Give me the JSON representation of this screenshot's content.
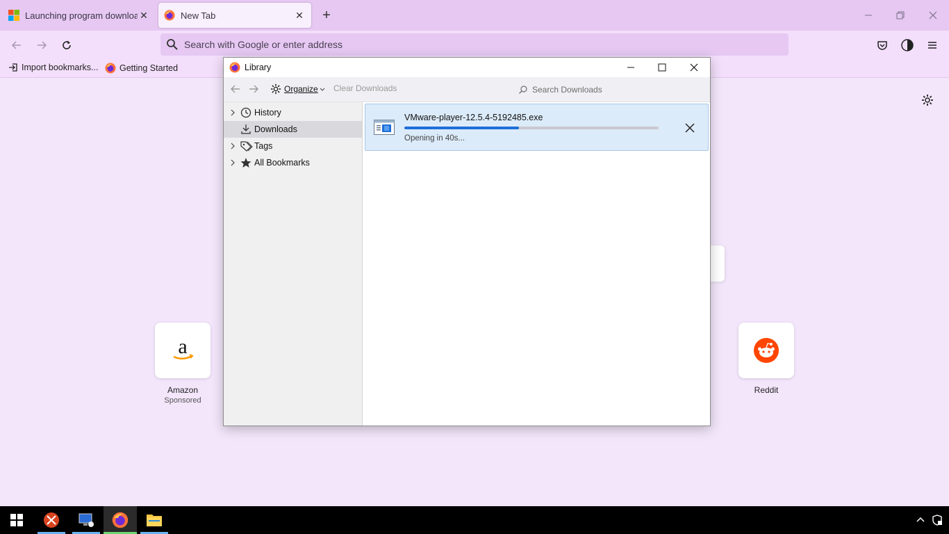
{
  "browser": {
    "tabs": [
      {
        "label": "Launching program download",
        "active": false
      },
      {
        "label": "New Tab",
        "active": true
      }
    ],
    "url_placeholder": "Search with Google or enter address",
    "bookmarks": [
      {
        "label": "Import bookmarks..."
      },
      {
        "label": "Getting Started"
      }
    ]
  },
  "newtab": {
    "shortcuts": [
      {
        "name": "Amazon",
        "sub": "Sponsored"
      },
      {
        "name": "Reddit",
        "sub": ""
      }
    ]
  },
  "library": {
    "title": "Library",
    "toolbar": {
      "organize": "Organize",
      "clear": "Clear Downloads",
      "search_placeholder": "Search Downloads"
    },
    "sidebar": [
      {
        "label": "History",
        "icon": "clock-icon",
        "expandable": true,
        "selected": false
      },
      {
        "label": "Downloads",
        "icon": "download-icon",
        "expandable": false,
        "selected": true
      },
      {
        "label": "Tags",
        "icon": "tag-icon",
        "expandable": true,
        "selected": false
      },
      {
        "label": "All Bookmarks",
        "icon": "star-icon",
        "expandable": true,
        "selected": false
      }
    ],
    "download": {
      "filename": "VMware-player-12.5.4-5192485.exe",
      "status": "Opening in 40s...",
      "progress": 0.45
    }
  },
  "colors": {
    "accent": "#1e6fd9",
    "selected_row": "#dcebf9",
    "tabbar": "#e6c8f3",
    "page_bg": "#f3e6fb"
  }
}
